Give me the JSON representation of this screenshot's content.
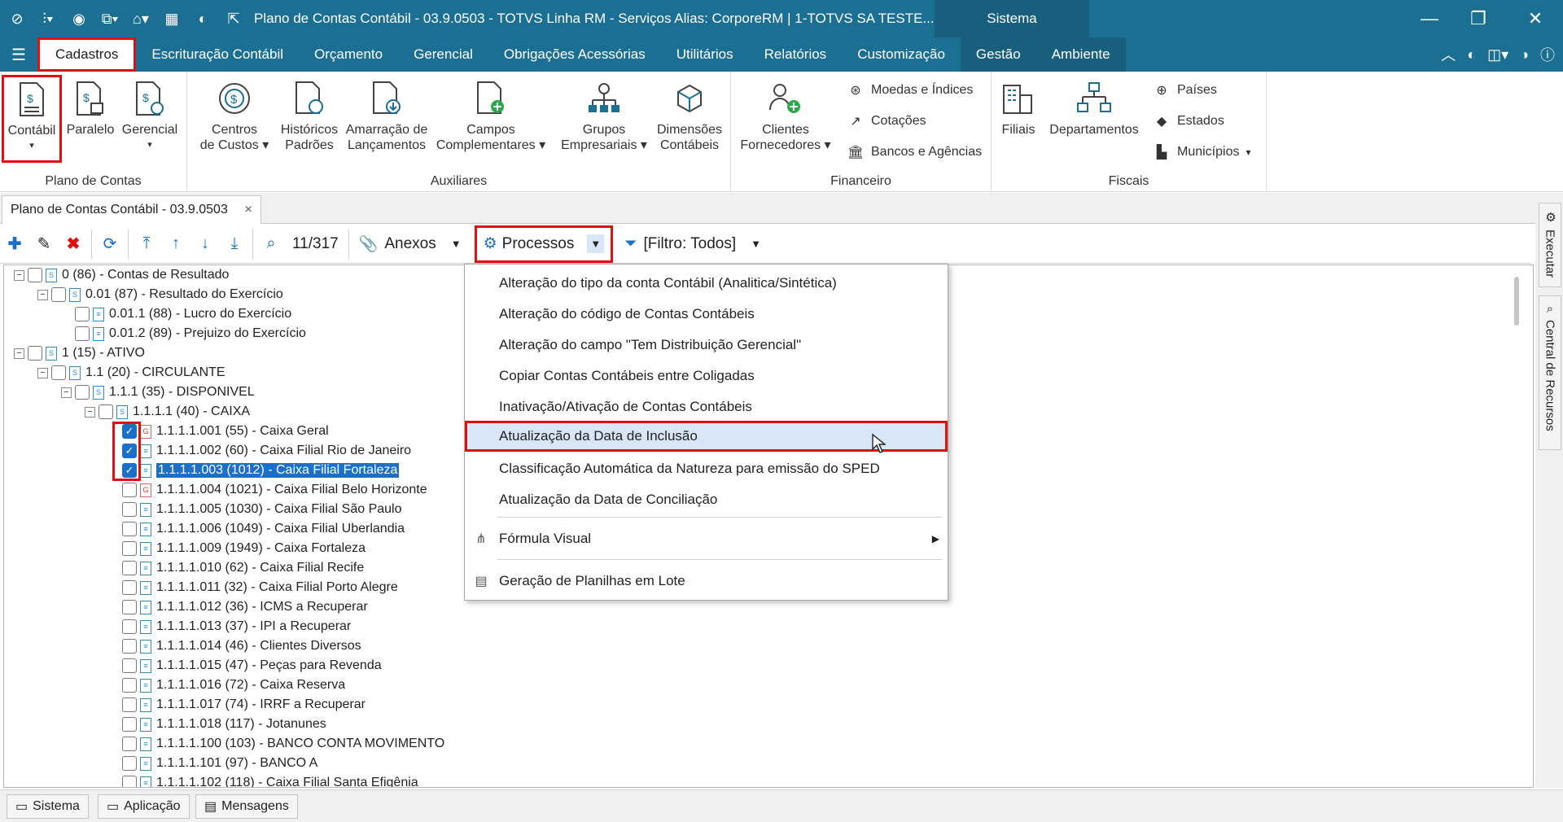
{
  "titlebar": {
    "title": "Plano de Contas Contábil - 03.9.0503 - TOTVS Linha RM - Serviços  Alias: CorporeRM | 1-TOTVS SA TESTE...",
    "sistema": "Sistema"
  },
  "menu": {
    "items": [
      "Cadastros",
      "Escrituração Contábil",
      "Orçamento",
      "Gerencial",
      "Obrigações Acessórias",
      "Utilitários",
      "Relatórios",
      "Customização",
      "Gestão",
      "Ambiente"
    ]
  },
  "ribbon": {
    "plano": {
      "label": "Plano de Contas",
      "contabil": "Contábil",
      "paralelo": "Paralelo",
      "gerencial": "Gerencial"
    },
    "aux": {
      "label": "Auxiliares",
      "centros1": "Centros",
      "centros2": "de Custos",
      "historicos1": "Históricos",
      "historicos2": "Padrões",
      "amarracao1": "Amarração de",
      "amarracao2": "Lançamentos",
      "campos1": "Campos",
      "campos2": "Complementares",
      "grupos1": "Grupos",
      "grupos2": "Empresariais",
      "dimensoes1": "Dimensões",
      "dimensoes2": "Contábeis"
    },
    "fin": {
      "label": "Financeiro",
      "clientes1": "Clientes",
      "clientes2": "Fornecedores",
      "moedas": "Moedas e Índices",
      "cotacoes": "Cotações",
      "bancos": "Bancos e Agências"
    },
    "fiscais": {
      "label": "Fiscais",
      "filiais": "Filiais",
      "departamentos": "Departamentos",
      "paises": "Países",
      "estados": "Estados",
      "municipios": "Municípios"
    }
  },
  "tab": {
    "label": "Plano de Contas Contábil - 03.9.0503",
    "close": "×"
  },
  "toolbar": {
    "counter": "11/317",
    "anexos": "Anexos",
    "processos": "Processos",
    "filtro": "[Filtro: Todos]"
  },
  "tree": [
    {
      "text": "0 (86) - Contas de Resultado",
      "level": 0,
      "exp": "−",
      "ico": "S",
      "checked": false
    },
    {
      "text": "0.01 (87) - Resultado do Exercício",
      "level": 1,
      "exp": "−",
      "ico": "S",
      "checked": false
    },
    {
      "text": "0.01.1 (88) - Lucro do Exercício",
      "level": 2,
      "exp": "",
      "ico": "doc",
      "checked": false
    },
    {
      "text": "0.01.2 (89) - Prejuizo do Exercício",
      "level": 2,
      "exp": "",
      "ico": "doc",
      "checked": false
    },
    {
      "text": "1 (15) - ATIVO",
      "level": 0,
      "exp": "−",
      "ico": "S",
      "checked": false
    },
    {
      "text": "1.1 (20) - CIRCULANTE",
      "level": 1,
      "exp": "−",
      "ico": "S",
      "checked": false
    },
    {
      "text": "1.1.1 (35) - DISPONIVEL",
      "level": 2,
      "exp": "−",
      "ico": "S",
      "checked": false
    },
    {
      "text": "1.1.1.1 (40) - CAIXA",
      "level": 3,
      "exp": "−",
      "ico": "S",
      "checked": false
    },
    {
      "text": "1.1.1.1.001 (55) - Caixa Geral",
      "level": 4,
      "exp": "",
      "ico": "G",
      "checked": true
    },
    {
      "text": "1.1.1.1.002 (60) - Caixa Filial Rio de Janeiro",
      "level": 4,
      "exp": "",
      "ico": "doc",
      "checked": true
    },
    {
      "text": "1.1.1.1.003 (1012) - Caixa Filial Fortaleza",
      "level": 4,
      "exp": "",
      "ico": "doc",
      "checked": true,
      "selected": true
    },
    {
      "text": "1.1.1.1.004 (1021) - Caixa Filial Belo Horizonte",
      "level": 4,
      "exp": "",
      "ico": "G",
      "checked": false
    },
    {
      "text": "1.1.1.1.005 (1030) - Caixa Filial São Paulo",
      "level": 4,
      "exp": "",
      "ico": "doc",
      "checked": false
    },
    {
      "text": "1.1.1.1.006 (1049) - Caixa Filial Uberlandia",
      "level": 4,
      "exp": "",
      "ico": "doc",
      "checked": false
    },
    {
      "text": "1.1.1.1.009 (1949) - Caixa Fortaleza",
      "level": 4,
      "exp": "",
      "ico": "doc",
      "checked": false
    },
    {
      "text": "1.1.1.1.010 (62) - Caixa Filial Recife",
      "level": 4,
      "exp": "",
      "ico": "doc",
      "checked": false
    },
    {
      "text": "1.1.1.1.011 (32) - Caixa Filial Porto Alegre",
      "level": 4,
      "exp": "",
      "ico": "doc",
      "checked": false
    },
    {
      "text": "1.1.1.1.012 (36) - ICMS a Recuperar",
      "level": 4,
      "exp": "",
      "ico": "doc",
      "checked": false
    },
    {
      "text": "1.1.1.1.013 (37) - IPI a Recuperar",
      "level": 4,
      "exp": "",
      "ico": "doc",
      "checked": false
    },
    {
      "text": "1.1.1.1.014 (46) - Clientes Diversos",
      "level": 4,
      "exp": "",
      "ico": "doc",
      "checked": false
    },
    {
      "text": "1.1.1.1.015 (47) - Peças para Revenda",
      "level": 4,
      "exp": "",
      "ico": "doc",
      "checked": false
    },
    {
      "text": "1.1.1.1.016 (72) - Caixa Reserva",
      "level": 4,
      "exp": "",
      "ico": "doc",
      "checked": false
    },
    {
      "text": "1.1.1.1.017 (74) - IRRF a Recuperar",
      "level": 4,
      "exp": "",
      "ico": "doc",
      "checked": false
    },
    {
      "text": "1.1.1.1.018 (117) - Jotanunes",
      "level": 4,
      "exp": "",
      "ico": "doc",
      "checked": false
    },
    {
      "text": "1.1.1.1.100 (103) - BANCO CONTA MOVIMENTO",
      "level": 4,
      "exp": "",
      "ico": "doc",
      "checked": false
    },
    {
      "text": "1.1.1.1.101 (97) - BANCO A",
      "level": 4,
      "exp": "",
      "ico": "doc",
      "checked": false
    },
    {
      "text": "1.1.1.1.102 (118) - Caixa Filial Santa Efigênia",
      "level": 4,
      "exp": "",
      "ico": "doc",
      "checked": false
    }
  ],
  "dropdown": {
    "items": [
      "Alteração do tipo da conta Contábil (Analitica/Sintética)",
      "Alteração do código de Contas Contábeis",
      "Alteração do campo \"Tem Distribuição Gerencial\"",
      "Copiar Contas Contábeis entre Coligadas",
      "Inativação/Ativação de Contas Contábeis",
      "Atualização da Data de Inclusão",
      "Classificação Automática da Natureza para emissão do SPED",
      "Atualização da Data de Conciliação"
    ],
    "formula": "Fórmula Visual",
    "geracao": "Geração de Planilhas em Lote"
  },
  "side": {
    "executar": "Executar",
    "central": "Central de Recursos"
  },
  "status": {
    "sistema": "Sistema",
    "aplicacao": "Aplicação",
    "mensagens": "Mensagens"
  },
  "colors": {
    "titlebar": "#1b6f92",
    "highlight": "#e01010",
    "selection": "#1f6fc5"
  }
}
